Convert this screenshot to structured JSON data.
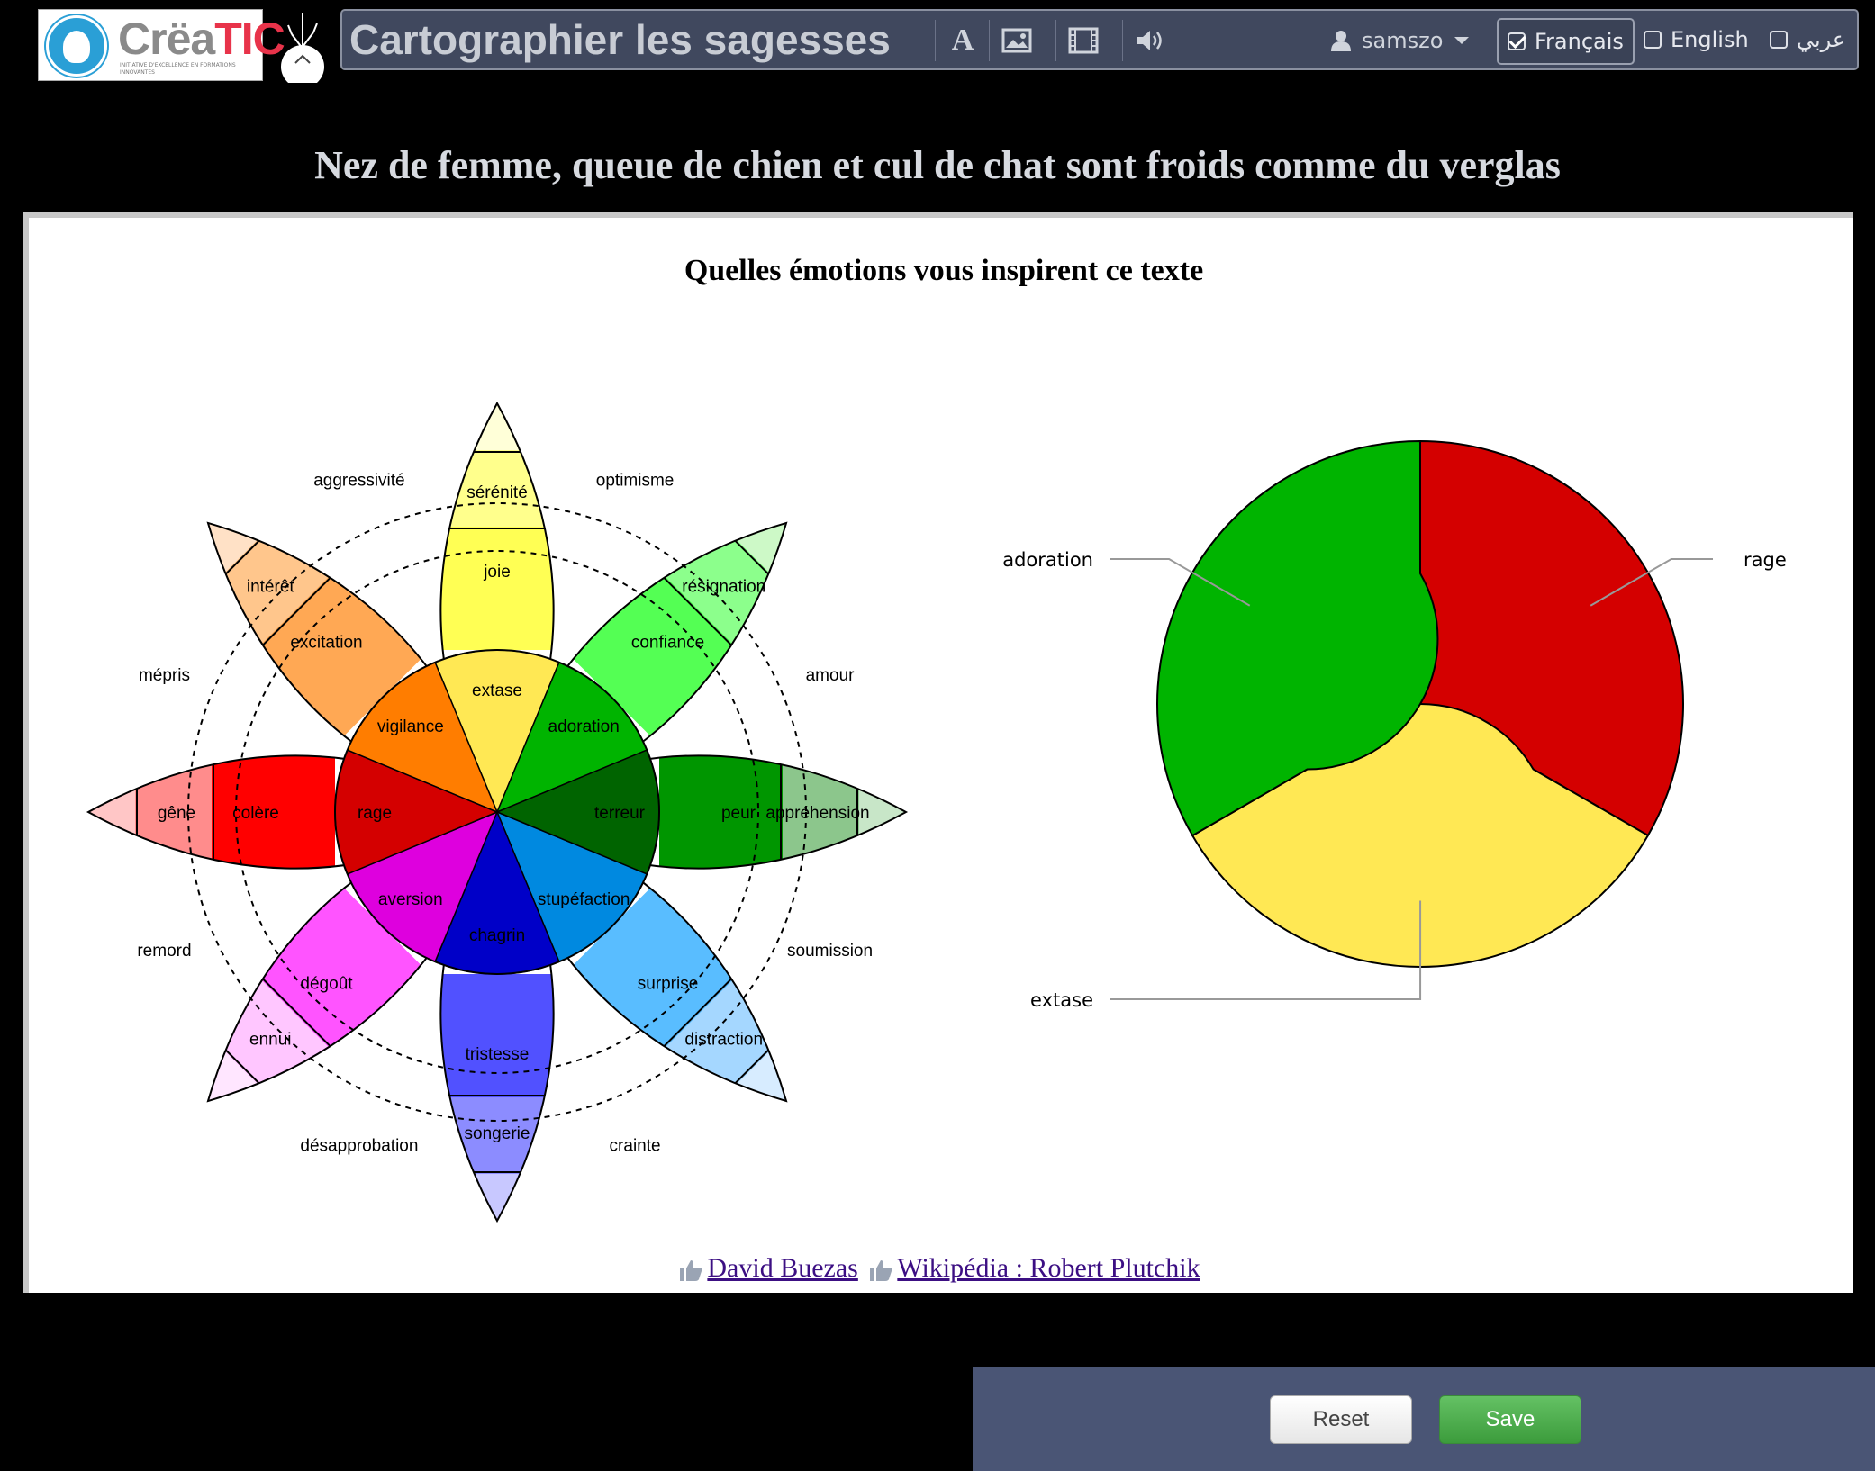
{
  "header": {
    "logo_text_1": "Crëa",
    "logo_text_2": "TIC",
    "logo_sub": "INITIATIVE D'EXCELLENCE EN FORMATIONS INNOVANTES",
    "app_title": "Cartographier les sagesses",
    "user_name": "samszo",
    "languages": [
      {
        "label": "Français",
        "checked": true
      },
      {
        "label": "English",
        "checked": false
      },
      {
        "label": "عربي",
        "checked": false
      }
    ]
  },
  "page_heading": "Nez de femme, queue de chien et cul de chat sont froids comme du verglas",
  "panel_title": "Quelles émotions vous inspirent ce texte",
  "wheel": {
    "dyads": [
      "optimisme",
      "amour",
      "soumission",
      "crainte",
      "désapprobation",
      "remord",
      "mépris",
      "aggressivité"
    ],
    "petals": [
      {
        "outer": "sérénité",
        "mid": "joie",
        "inner": "extase",
        "colors": [
          "#ffffd8",
          "#ffff8c",
          "#ffff54",
          "#ffe854"
        ]
      },
      {
        "outer": "résignation",
        "mid": "confiance",
        "inner": "adoration",
        "colors": [
          "#cdf9c7",
          "#8cff8c",
          "#54ff54",
          "#00b400"
        ]
      },
      {
        "outer": "appréhension",
        "mid": "peur",
        "inner": "terreur",
        "colors": [
          "#c8e6c8",
          "#8cc68c",
          "#009600",
          "#006400"
        ]
      },
      {
        "outer": "distraction",
        "mid": "surprise",
        "inner": "stupéfaction",
        "colors": [
          "#d7ecff",
          "#a5d7ff",
          "#59bdff",
          "#0089e0"
        ]
      },
      {
        "outer": "songerie",
        "mid": "tristesse",
        "inner": "chagrin",
        "colors": [
          "#c8c8ff",
          "#8c8cff",
          "#5151ff",
          "#0000c8"
        ]
      },
      {
        "outer": "ennui",
        "mid": "dégoût",
        "inner": "aversion",
        "colors": [
          "#ffe6ff",
          "#ffc6ff",
          "#ff54ff",
          "#de00de"
        ]
      },
      {
        "outer": "gêne",
        "mid": "colère",
        "inner": "rage",
        "colors": [
          "#ffc6c6",
          "#ff8c8c",
          "#ff0000",
          "#d40000"
        ]
      },
      {
        "outer": "intérêt",
        "mid": "excitation",
        "inner": "vigilance",
        "colors": [
          "#ffe1c6",
          "#ffc68c",
          "#ffa854",
          "#ff7d00"
        ]
      }
    ]
  },
  "donut": {
    "slices": [
      {
        "label": "rage",
        "share": 0.3333,
        "color": "#d40000",
        "label_side": "right"
      },
      {
        "label": "extase",
        "share": 0.3333,
        "color": "#ffe854",
        "label_side": "left"
      },
      {
        "label": "adoration",
        "share": 0.3334,
        "color": "#00b400",
        "label_side": "left"
      }
    ]
  },
  "actions": {
    "reset_label": "Reset",
    "save_label": "Save"
  },
  "credits": [
    {
      "label": "David Buezas"
    },
    {
      "label": "Wikipédia : Robert Plutchik"
    }
  ],
  "icons": [
    "font-icon",
    "image-icon",
    "video-icon",
    "sound-icon",
    "user-icon",
    "caret-down-icon",
    "thumbs-up-icon",
    "tree-icon"
  ]
}
